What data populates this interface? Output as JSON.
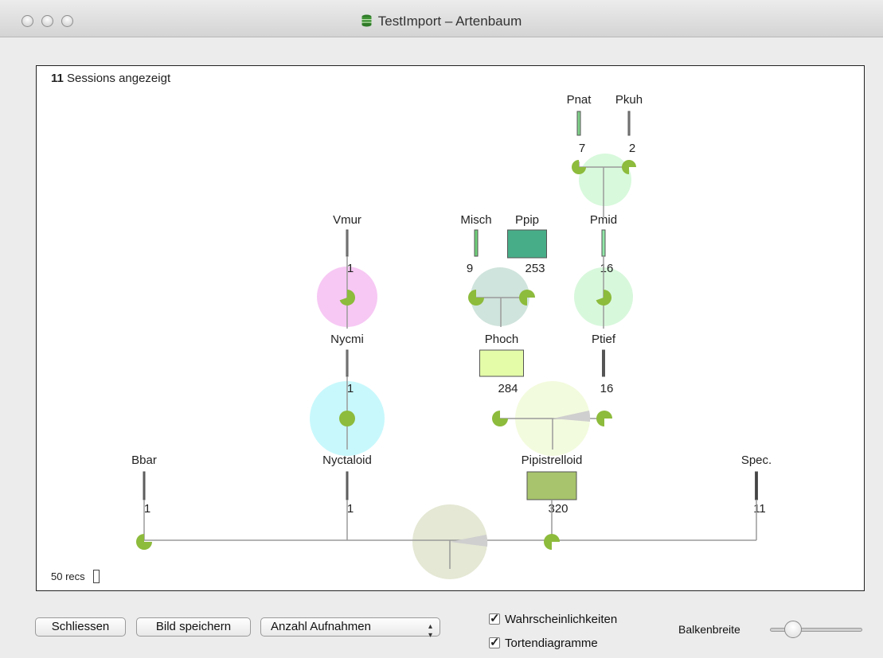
{
  "window": {
    "title": "TestImport – Artenbaum",
    "title_icon": "database-icon"
  },
  "canvas": {
    "session_count": "11",
    "session_suffix": "Sessions angezeigt",
    "recs_label": "50 recs"
  },
  "tree": {
    "nodes": [
      {
        "key": "pnat",
        "label": "Pnat",
        "count": "7",
        "color": "#7fd18a"
      },
      {
        "key": "pkuh",
        "label": "Pkuh",
        "count": "2",
        "color": "#8a8a8a"
      },
      {
        "key": "vmur",
        "label": "Vmur",
        "count": "1",
        "color": "#8a8a8a"
      },
      {
        "key": "misch",
        "label": "Misch",
        "count": "9",
        "color": "#6fd07a"
      },
      {
        "key": "ppip",
        "label": "Ppip",
        "count": "253",
        "color": "#47ad88"
      },
      {
        "key": "pmid",
        "label": "Pmid",
        "count": "16",
        "color": "#8fe8a8"
      },
      {
        "key": "nycmi",
        "label": "Nycmi",
        "count": "1",
        "color": "#8a8a8a"
      },
      {
        "key": "phoch",
        "label": "Phoch",
        "count": "284",
        "color": "#e4fca8"
      },
      {
        "key": "ptief",
        "label": "Ptief",
        "count": "16",
        "color": "#555555"
      },
      {
        "key": "bbar",
        "label": "Bbar",
        "count": "1",
        "color": "#666666"
      },
      {
        "key": "nyctaloid",
        "label": "Nyctaloid",
        "count": "1",
        "color": "#666666"
      },
      {
        "key": "pipistrelloid",
        "label": "Pipistrelloid",
        "count": "320",
        "color": "#a8c46c"
      },
      {
        "key": "spec",
        "label": "Spec.",
        "count": "11",
        "color": "#444444"
      }
    ],
    "group_colors": {
      "pnat_pkuh": "#d4f8d8",
      "vmur": "#f7c8f4",
      "misch_ppip": "#cfe4dc",
      "pmid": "#d8f8dc",
      "nycmi": "#c8f8fc",
      "phoch_ptief": "#f3fbde",
      "root": "#e4e8d4",
      "pie_green": "#8dbb3c"
    }
  },
  "controls": {
    "close_button": "Schliessen",
    "save_button": "Bild speichern",
    "metric_select": "Anzahl Aufnahmen",
    "checkbox_probabilities": "Wahrscheinlichkeiten",
    "checkbox_pies": "Tortendiagramme",
    "slider_label": "Balkenbreite"
  }
}
